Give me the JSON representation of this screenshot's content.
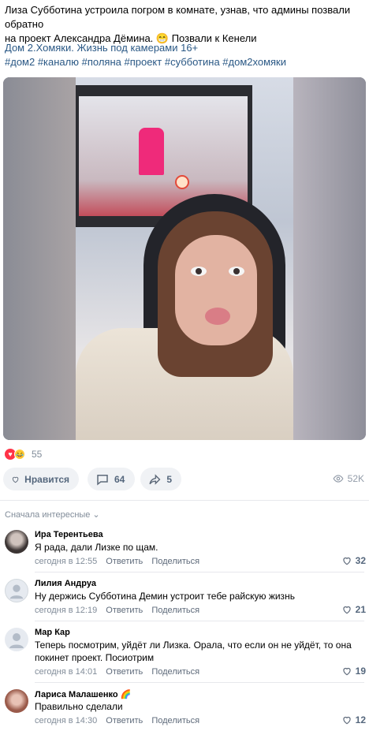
{
  "post": {
    "text_line1": "Лиза Субботина устроила погром в комнате, узнав, что админы позвали обратно",
    "text_line2": "на проект Александра Дёмина. 😁 Позвали к Кенели",
    "source": "Дом 2.Хомяки. Жизнь под камерами 16+",
    "hashtags": "#дом2 #каналю #поляна #проект #субботина #дом2хомяки"
  },
  "reactions": {
    "count": "55",
    "icons": [
      "heart-reaction",
      "laugh-reaction"
    ]
  },
  "actions": {
    "like_label": "Нравится",
    "comments_count": "64",
    "share_count": "5",
    "views": "52K"
  },
  "comments_sort": "Сначала интересные",
  "comments": [
    {
      "name": "Ира Терентьева",
      "text": "Я рада, дали Лизке по щам.",
      "time": "сегодня в 12:55",
      "reply": "Ответить",
      "share": "Поделиться",
      "likes": "32"
    },
    {
      "name": "Лилия Андруа",
      "text": "Ну держись Субботина Демин устроит тебе райскую жизнь",
      "time": "сегодня в 12:19",
      "reply": "Ответить",
      "share": "Поделиться",
      "likes": "21"
    },
    {
      "name": "Мар Кар",
      "text": "Теперь посмотрим, уйдёт ли Лизка. Орала, что если он не уйдёт, то она покинет проект. Посиотрим",
      "time": "сегодня в 14:01",
      "reply": "Ответить",
      "share": "Поделиться",
      "likes": "19"
    },
    {
      "name": "Лариса Малашенко 🌈",
      "text": "Правильно сделали",
      "time": "сегодня в 14:30",
      "reply": "Ответить",
      "share": "Поделиться",
      "likes": "12"
    }
  ],
  "colors": {
    "link": "#2a5885",
    "muted": "#818c99",
    "button_bg": "#f0f2f5",
    "button_text": "#55677d"
  }
}
